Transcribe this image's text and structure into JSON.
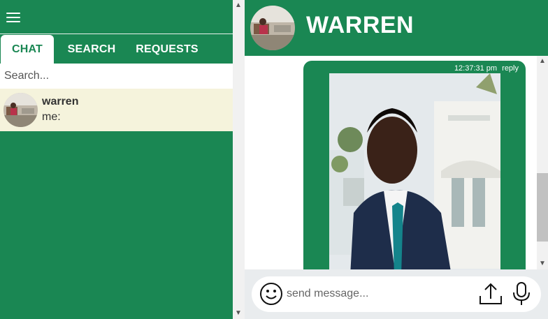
{
  "sidebar": {
    "tabs": [
      {
        "label": "CHAT",
        "active": true
      },
      {
        "label": "SEARCH",
        "active": false
      },
      {
        "label": "REQUESTS",
        "active": false
      }
    ],
    "search": {
      "placeholder": "Search..."
    },
    "chats": [
      {
        "name": "warren",
        "preview": "me:"
      }
    ]
  },
  "conversation": {
    "title": "WARREN",
    "messages": [
      {
        "time": "12:37:31 pm",
        "reply_label": "reply",
        "type": "image"
      }
    ],
    "composer": {
      "placeholder": "send message..."
    }
  },
  "colors": {
    "brand": "#1a8753",
    "chat_item_bg": "#f5f3dc",
    "composer_bg": "#e9ecee"
  },
  "icons": [
    "menu-icon",
    "smiley-icon",
    "upload-icon",
    "microphone-icon"
  ]
}
